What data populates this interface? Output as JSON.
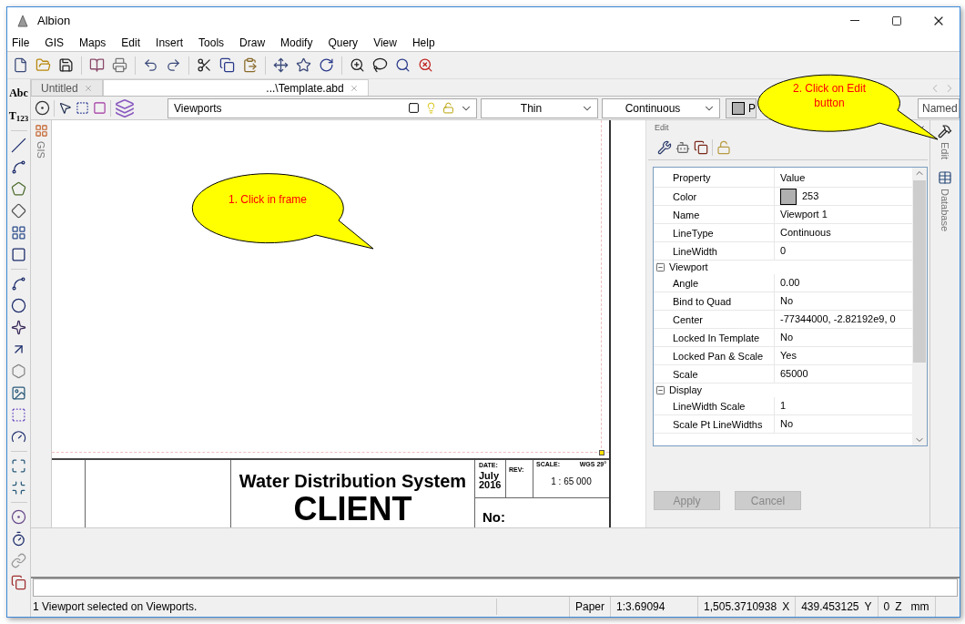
{
  "window": {
    "title": "Albion"
  },
  "menu": [
    "File",
    "GIS",
    "Maps",
    "Edit",
    "Insert",
    "Tools",
    "Draw",
    "Modify",
    "Query",
    "View",
    "Help"
  ],
  "left_tools": [
    {
      "kind": "text",
      "label": "Abc"
    },
    {
      "kind": "text",
      "label": "T$_{123}$"
    }
  ],
  "tabs": [
    {
      "label": "Untitled",
      "selected": false
    },
    {
      "label": "...\\Template.abd",
      "selected": true
    }
  ],
  "layer_bar": {
    "layer": "Viewports",
    "line_width": "Thin",
    "line_type": "Continuous",
    "color_label": "P",
    "named": "Named"
  },
  "side_tabs_left": [
    "GIS"
  ],
  "title_block": {
    "title": "Water Distribution System",
    "client": "CLIENT",
    "date_label": "DATE:",
    "date": "July 2016",
    "rev_label": "REV:",
    "scale_label": "SCALE:",
    "datum": "WGS 29°",
    "scale": "1 : 65 000",
    "number_label": "No:"
  },
  "edit_panel": {
    "title": "Edit",
    "columns": [
      "Property",
      "Value"
    ],
    "rows": [
      {
        "kind": "color",
        "name": "Color",
        "value": "253"
      },
      {
        "kind": "text",
        "name": "Name",
        "value": "Viewport 1"
      },
      {
        "kind": "text",
        "name": "LineType",
        "value": "Continuous"
      },
      {
        "kind": "text",
        "name": "LineWidth",
        "value": "0"
      }
    ],
    "groups": [
      {
        "label": "Viewport",
        "expanded": true,
        "rows": [
          {
            "kind": "text",
            "name": "Angle",
            "value": "0.00"
          },
          {
            "kind": "text",
            "name": "Bind to Quad",
            "value": "No"
          },
          {
            "kind": "text",
            "name": "Center",
            "value": "-77344000, -2.82192e9, 0"
          },
          {
            "kind": "text",
            "name": "Locked In Template",
            "value": "No"
          },
          {
            "kind": "text",
            "name": "Locked Pan & Scale",
            "value": "Yes"
          },
          {
            "kind": "text",
            "name": "Scale",
            "value": "65000"
          }
        ]
      },
      {
        "label": "Display",
        "expanded": true,
        "rows": [
          {
            "kind": "text",
            "name": "LineWidth Scale",
            "value": "1"
          },
          {
            "kind": "text",
            "name": "Scale Pt LineWidths",
            "value": "No"
          }
        ]
      }
    ],
    "buttons": [
      {
        "label": "Apply",
        "disabled": true
      },
      {
        "label": "Cancel",
        "disabled": true
      }
    ]
  },
  "side_tabs_right": [
    "Edit",
    "Database"
  ],
  "status_bar": {
    "message": "1 Viewport selected on Viewports.",
    "cells": [
      {
        "value": "Paper"
      },
      {
        "value": "1:3.69094"
      },
      {
        "value": "1,505.3710938",
        "axis": "X"
      },
      {
        "value": "439.453125",
        "axis": "Y"
      },
      {
        "value": "0",
        "axis": "Z",
        "unit": "mm"
      }
    ]
  },
  "callouts": [
    {
      "text": "1. Click in frame"
    },
    {
      "text": "2. Click on Edit button"
    }
  ]
}
